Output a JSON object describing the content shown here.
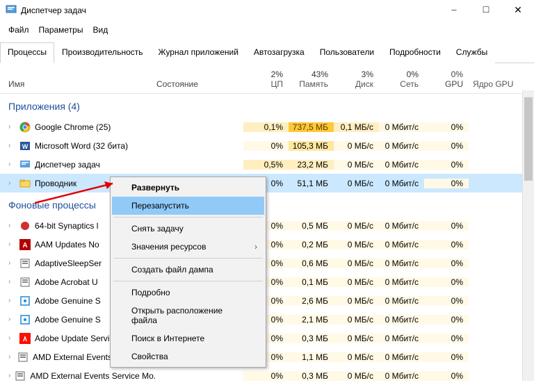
{
  "window": {
    "title": "Диспетчер задач"
  },
  "menu": {
    "file": "Файл",
    "params": "Параметры",
    "view": "Вид"
  },
  "tabs": {
    "processes": "Процессы",
    "performance": "Производительность",
    "app_history": "Журнал приложений",
    "startup": "Автозагрузка",
    "users": "Пользователи",
    "details": "Подробности",
    "services": "Службы"
  },
  "columns": {
    "name": "Имя",
    "state": "Состояние",
    "cpu_label": "ЦП",
    "cpu_pct": "2%",
    "mem_label": "Память",
    "mem_pct": "43%",
    "disk_label": "Диск",
    "disk_pct": "3%",
    "net_label": "Сеть",
    "net_pct": "0%",
    "gpu_label": "GPU",
    "gpu_pct": "0%",
    "gpu_engine": "Ядро GPU"
  },
  "groups": {
    "apps": "Приложения (4)",
    "bg": "Фоновые процессы"
  },
  "rows": [
    {
      "grp": "apps",
      "name": "Google Chrome (25)",
      "icon": "chrome",
      "cpu": "0,1%",
      "mem": "737,5 МБ",
      "disk": "0,1 МБ/с",
      "net": "0 Мбит/с",
      "gpu": "0%",
      "cpu_h": 1,
      "mem_h": 4,
      "disk_h": 1,
      "net_h": 0,
      "gpu_h": 0
    },
    {
      "grp": "apps",
      "name": "Microsoft Word (32 бита)",
      "icon": "word",
      "cpu": "0%",
      "mem": "105,3 МБ",
      "disk": "0 МБ/с",
      "net": "0 Мбит/с",
      "gpu": "0%",
      "cpu_h": 0,
      "mem_h": 2,
      "disk_h": 0,
      "net_h": 0,
      "gpu_h": 0
    },
    {
      "grp": "apps",
      "name": "Диспетчер задач",
      "icon": "taskmgr",
      "cpu": "0,5%",
      "mem": "23,2 МБ",
      "disk": "0 МБ/с",
      "net": "0 Мбит/с",
      "gpu": "0%",
      "cpu_h": 1,
      "mem_h": 1,
      "disk_h": 0,
      "net_h": 0,
      "gpu_h": 0
    },
    {
      "grp": "apps",
      "name": "Проводник",
      "icon": "explorer",
      "cpu": "0%",
      "mem": "51,1 МБ",
      "disk": "0 МБ/с",
      "net": "0 Мбит/с",
      "gpu": "0%",
      "selected": true,
      "cpu_h": 0,
      "mem_h": 1,
      "disk_h": 0,
      "net_h": 0,
      "gpu_h": 0
    },
    {
      "grp": "bg",
      "name": "64-bit Synaptics l",
      "icon": "syn",
      "cpu": "0%",
      "mem": "0,5 МБ",
      "disk": "0 МБ/с",
      "net": "0 Мбит/с",
      "gpu": "0%",
      "cpu_h": 0,
      "mem_h": 0,
      "disk_h": 0,
      "net_h": 0,
      "gpu_h": 0,
      "trunc": true
    },
    {
      "grp": "bg",
      "name": "AAM Updates No",
      "icon": "adobe-a",
      "cpu": "0%",
      "mem": "0,2 МБ",
      "disk": "0 МБ/с",
      "net": "0 Мбит/с",
      "gpu": "0%",
      "cpu_h": 0,
      "mem_h": 0,
      "disk_h": 0,
      "net_h": 0,
      "gpu_h": 0,
      "trunc": true
    },
    {
      "grp": "bg",
      "name": "AdaptiveSleepSer",
      "icon": "svc",
      "cpu": "0%",
      "mem": "0,6 МБ",
      "disk": "0 МБ/с",
      "net": "0 Мбит/с",
      "gpu": "0%",
      "cpu_h": 0,
      "mem_h": 0,
      "disk_h": 0,
      "net_h": 0,
      "gpu_h": 0,
      "trunc": true
    },
    {
      "grp": "bg",
      "name": "Adobe Acrobat U",
      "icon": "svc",
      "cpu": "0%",
      "mem": "0,1 МБ",
      "disk": "0 МБ/с",
      "net": "0 Мбит/с",
      "gpu": "0%",
      "cpu_h": 0,
      "mem_h": 0,
      "disk_h": 0,
      "net_h": 0,
      "gpu_h": 0,
      "trunc": true
    },
    {
      "grp": "bg",
      "name": "Adobe Genuine S",
      "icon": "adobe",
      "cpu": "0%",
      "mem": "2,6 МБ",
      "disk": "0 МБ/с",
      "net": "0 Мбит/с",
      "gpu": "0%",
      "cpu_h": 0,
      "mem_h": 0,
      "disk_h": 0,
      "net_h": 0,
      "gpu_h": 0,
      "trunc": true
    },
    {
      "grp": "bg",
      "name": "Adobe Genuine S",
      "icon": "adobe",
      "cpu": "0%",
      "mem": "2,1 МБ",
      "disk": "0 МБ/с",
      "net": "0 Мбит/с",
      "gpu": "0%",
      "cpu_h": 0,
      "mem_h": 0,
      "disk_h": 0,
      "net_h": 0,
      "gpu_h": 0,
      "trunc": true
    },
    {
      "grp": "bg",
      "name": "Adobe Update Service (32 бита)",
      "icon": "adobe-red",
      "cpu": "0%",
      "mem": "0,3 МБ",
      "disk": "0 МБ/с",
      "net": "0 Мбит/с",
      "gpu": "0%",
      "cpu_h": 0,
      "mem_h": 0,
      "disk_h": 0,
      "net_h": 0,
      "gpu_h": 0
    },
    {
      "grp": "bg",
      "name": "AMD External Events Client Mo...",
      "icon": "svc",
      "cpu": "0%",
      "mem": "1,1 МБ",
      "disk": "0 МБ/с",
      "net": "0 Мбит/с",
      "gpu": "0%",
      "cpu_h": 0,
      "mem_h": 0,
      "disk_h": 0,
      "net_h": 0,
      "gpu_h": 0
    },
    {
      "grp": "bg",
      "name": "AMD External Events Service Mo...",
      "icon": "svc",
      "cpu": "0%",
      "mem": "0,3 МБ",
      "disk": "0 МБ/с",
      "net": "0 Мбит/с",
      "gpu": "0%",
      "cpu_h": 0,
      "mem_h": 0,
      "disk_h": 0,
      "net_h": 0,
      "gpu_h": 0
    }
  ],
  "context_menu": {
    "expand": "Развернуть",
    "restart": "Перезапустить",
    "end_task": "Снять задачу",
    "resource_values": "Значения ресурсов",
    "create_dump": "Создать файл дампа",
    "details": "Подробно",
    "open_location": "Открыть расположение файла",
    "search_online": "Поиск в Интернете",
    "properties": "Свойства"
  }
}
